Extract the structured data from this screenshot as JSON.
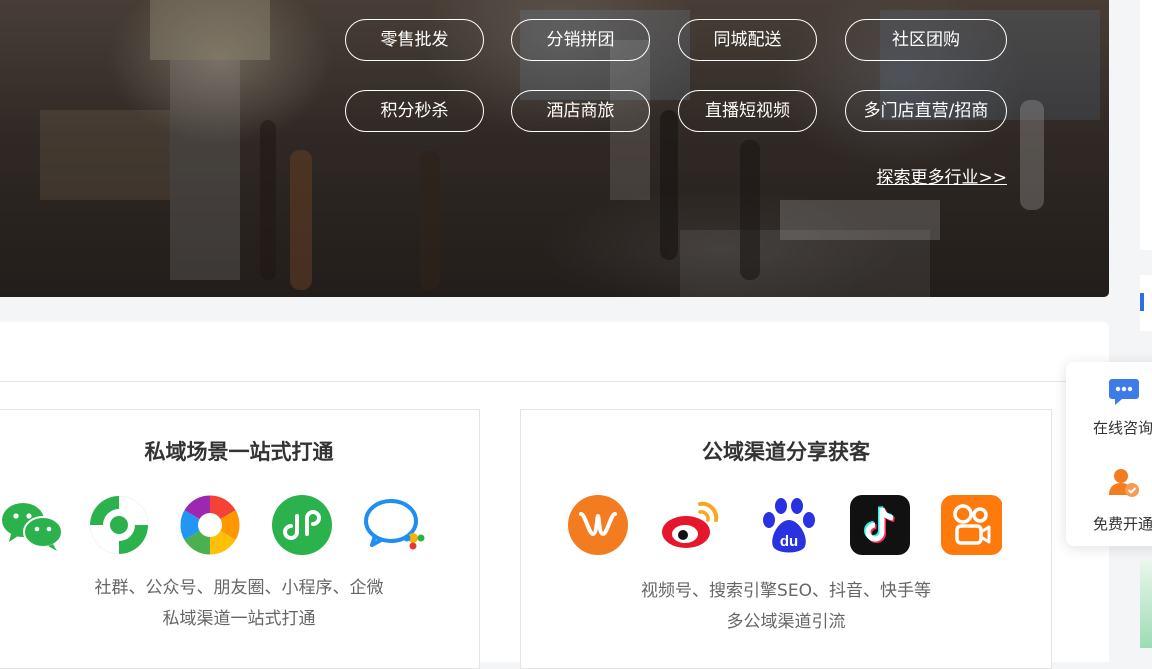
{
  "hero": {
    "industries": [
      "零售批发",
      "分销拼团",
      "同城配送",
      "社区团购",
      "积分秒杀",
      "酒店商旅",
      "直播短视频",
      "多门店直营/招商"
    ],
    "explore_link": "探索更多行业>>"
  },
  "cards": [
    {
      "title": "私域场景一站式打通",
      "icons": [
        "wechat-icon",
        "moments-logo-icon",
        "aperture-icon",
        "mini-program-icon",
        "wecom-icon"
      ],
      "desc_line1": "社群、公众号、朋友圈、小程序、企微",
      "desc_line2": "私域渠道一站式打通"
    },
    {
      "title": "公域渠道分享获客",
      "icons": [
        "video-account-icon",
        "weibo-icon",
        "baidu-icon",
        "douyin-icon",
        "kuaishou-icon"
      ],
      "desc_line1": "视频号、搜索引擎SEO、抖音、快手等",
      "desc_line2": "多公域渠道引流"
    }
  ],
  "float_bar": {
    "consult_label": "在线咨询",
    "trial_label": "免费开通"
  },
  "colors": {
    "wechat_green": "#2bb24c",
    "accent_orange": "#f47c20",
    "weibo_red": "#e6162d",
    "baidu_blue": "#2932e1",
    "douyin_black": "#111111",
    "kuaishou_orange": "#ff7a0d",
    "float_blue": "#3d7be8"
  }
}
